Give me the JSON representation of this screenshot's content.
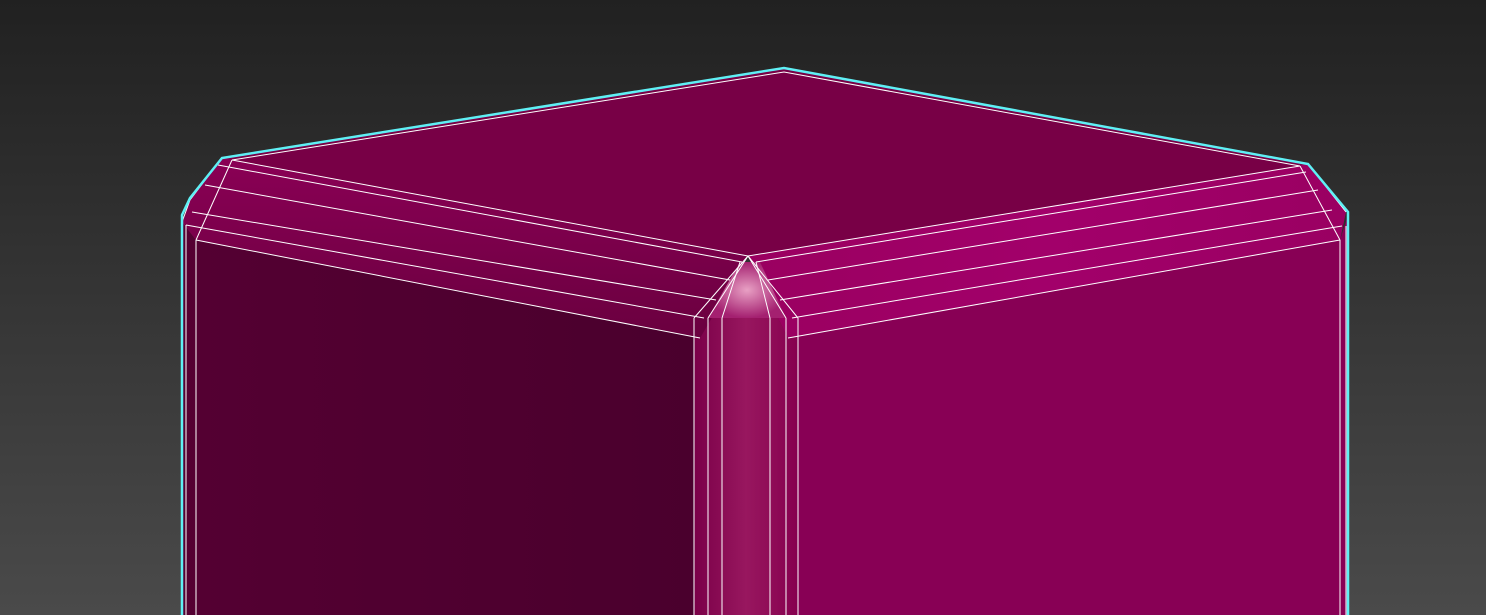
{
  "viewport": {
    "background_top": "#212121",
    "background_bottom": "#4a4a4a"
  },
  "object": {
    "shape": "chamfered box",
    "selected": true,
    "show_wireframe_edges": true,
    "colors": {
      "top_face": "#780046",
      "left_face": "#4d0030",
      "right_face": "#880055",
      "bevel_highlight": "#a0006a",
      "corner_edge": "#8e1058",
      "wire": "#ffffff",
      "selection_outline": "#5ff0f5"
    }
  }
}
